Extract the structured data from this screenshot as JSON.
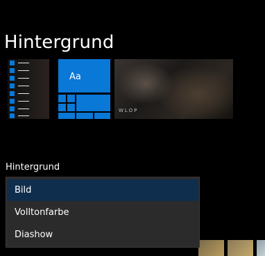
{
  "page": {
    "title": "Hintergrund"
  },
  "preview": {
    "tile_text": "Aa",
    "wallpaper_watermark": "WLOP"
  },
  "background_setting": {
    "label": "Hintergrund",
    "options": [
      "Bild",
      "Volltonfarbe",
      "Diashow"
    ],
    "selected": "Bild"
  },
  "colors": {
    "accent": "#0a78d7",
    "selected_bg": "#0f2e4d",
    "dropdown_bg": "#2b2b2b"
  }
}
